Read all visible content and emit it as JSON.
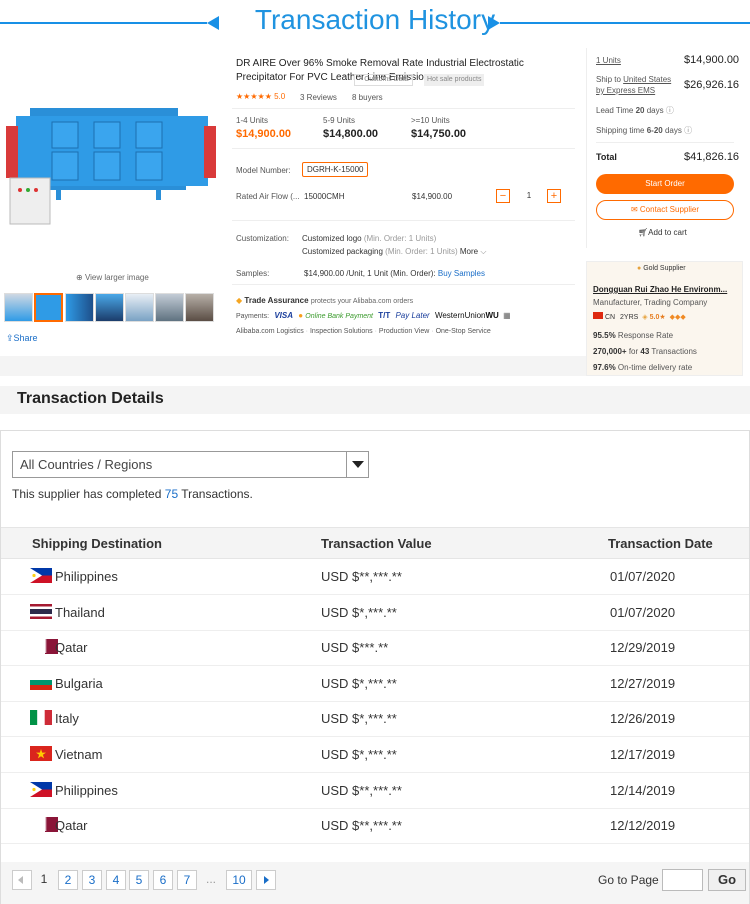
{
  "header": {
    "title": "Transaction History"
  },
  "product": {
    "title": "DR AIRE Over 96% Smoke Removal Rate Industrial Electrostatic Precipitator For PVC Leather Line Emission",
    "customs_tag": "Customs Data",
    "hot_tag": "Hot sale products",
    "rating": "5.0",
    "reviews": "3 Reviews",
    "buyers": "8 buyers",
    "view_larger": "View larger image",
    "share": "Share",
    "tiers": [
      {
        "range": "1-4 Units",
        "price": "$14,900.00"
      },
      {
        "range": "5-9 Units",
        "price": "$14,800.00"
      },
      {
        "range": ">=10 Units",
        "price": "$14,750.00"
      }
    ],
    "model_label": "Model Number:",
    "model_value": "DGRH-K-15000",
    "airflow_label": "Rated Air Flow (...",
    "airflow_value": "15000CMH",
    "airflow_price": "$14,900.00",
    "qty_minus": "−",
    "qty_value": "1",
    "qty_plus": "+",
    "customization_label": "Customization:",
    "custom_logo": "Customized logo",
    "custom_logo_min": "(Min. Order: 1 Units)",
    "custom_pack": "Customized packaging",
    "custom_pack_min": "(Min. Order: 1 Units)",
    "more": "More",
    "samples_label": "Samples:",
    "samples_value": "$14,900.00 /Unit, 1 Unit (Min. Order):",
    "buy_samples": "Buy Samples",
    "trade_assurance": "Trade Assurance",
    "trade_assurance_note": "protects your Alibaba.com orders",
    "payments_label": "Payments:",
    "payments": [
      "VISA",
      "Online Bank Payment",
      "T/T",
      "Pay Later",
      "WesternUnion",
      "WU"
    ],
    "services": [
      "Alibaba.com Logistics",
      "Inspection Solutions",
      "Production View",
      "One-Stop Service"
    ]
  },
  "order_panel": {
    "units": "1 Units",
    "units_price": "$14,900.00",
    "ship_to": "Ship to",
    "ship_country": "United States",
    "ship_by": "by Express EMS",
    "ship_price": "$26,926.16",
    "lead_time_label": "Lead Time",
    "lead_time_value": "20",
    "lead_time_unit": "days",
    "shipping_time_label": "Shipping time",
    "shipping_time_value": "6-20",
    "shipping_time_unit": "days",
    "total_label": "Total",
    "total_value": "$41,826.16",
    "start_order": "Start Order",
    "contact_supplier": "Contact Supplier",
    "add_to_cart": "Add to cart"
  },
  "supplier": {
    "badge": "Gold Supplier",
    "name": "Dongguan Rui Zhao He Environm...",
    "type": "Manufacturer, Trading Company",
    "country": "CN",
    "years": "2YRS",
    "score": "5.0",
    "response_rate": "95.5%",
    "response_label": "Response Rate",
    "transactions": "270,000+",
    "transactions_for": "for",
    "transactions_count": "43",
    "transactions_label": "Transactions",
    "ontime": "97.6%",
    "ontime_label": "On-time delivery rate"
  },
  "details": {
    "title": "Transaction Details",
    "region_select": "All Countries / Regions",
    "completed_prefix": "This supplier has completed",
    "completed_count": "75",
    "completed_suffix": "Transactions.",
    "columns": [
      "Shipping Destination",
      "Transaction Value",
      "Transaction Date"
    ],
    "rows": [
      {
        "country": "Philippines",
        "value": "USD $**,***.**",
        "date": "01/07/2020",
        "flag": "PH"
      },
      {
        "country": "Thailand",
        "value": "USD $*,***.**",
        "date": "01/07/2020",
        "flag": "TH"
      },
      {
        "country": "Qatar",
        "value": "USD $***.**",
        "date": "12/29/2019",
        "flag": "QA"
      },
      {
        "country": "Bulgaria",
        "value": "USD $*,***.**",
        "date": "12/27/2019",
        "flag": "BG"
      },
      {
        "country": "Italy",
        "value": "USD $*,***.**",
        "date": "12/26/2019",
        "flag": "IT"
      },
      {
        "country": "Vietnam",
        "value": "USD $*,***.**",
        "date": "12/17/2019",
        "flag": "VN"
      },
      {
        "country": "Philippines",
        "value": "USD $**,***.**",
        "date": "12/14/2019",
        "flag": "PH"
      },
      {
        "country": "Qatar",
        "value": "USD $**,***.**",
        "date": "12/12/2019",
        "flag": "QA"
      }
    ]
  },
  "pagination": {
    "pages": [
      "1",
      "2",
      "3",
      "4",
      "5",
      "6",
      "7"
    ],
    "ellipsis": "...",
    "last": "10",
    "goto_label": "Go to Page",
    "go": "Go"
  },
  "colors": {
    "accent": "#ff6a00",
    "brand_blue": "#1f93e0",
    "link": "#1a6ec8"
  }
}
